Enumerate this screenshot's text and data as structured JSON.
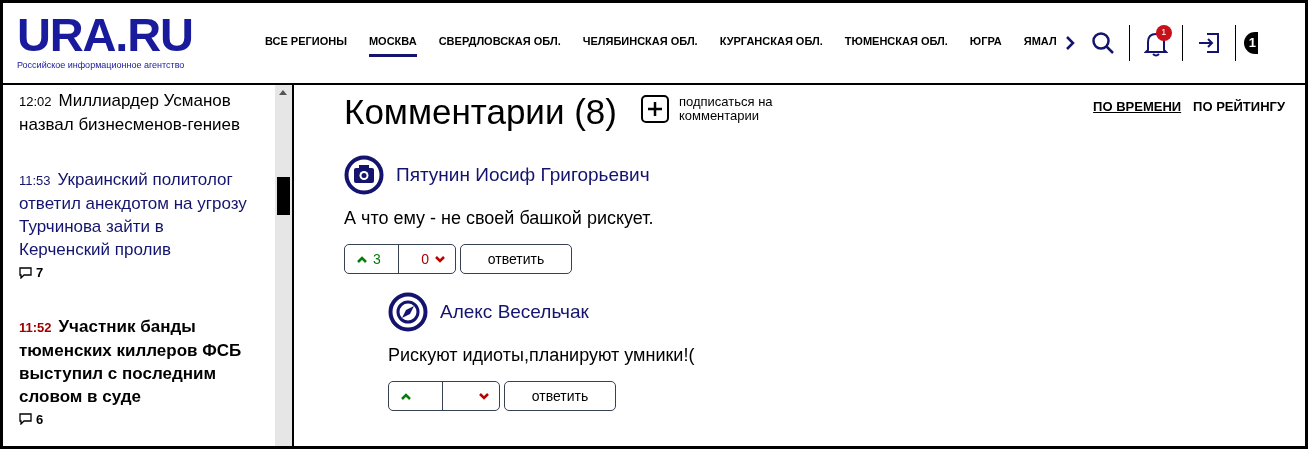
{
  "header": {
    "logo": "URA.RU",
    "tagline": "Российское информационное агентство",
    "nav": [
      {
        "label": "ВСЕ РЕГИОНЫ",
        "selected": false
      },
      {
        "label": "МОСКВА",
        "selected": true
      },
      {
        "label": "СВЕРДЛОВСКАЯ ОБЛ.",
        "selected": false
      },
      {
        "label": "ЧЕЛЯБИНСКАЯ ОБЛ.",
        "selected": false
      },
      {
        "label": "КУРГАНСКАЯ ОБЛ.",
        "selected": false
      },
      {
        "label": "ТЮМЕНСКАЯ ОБЛ.",
        "selected": false
      },
      {
        "label": "ЮГРА",
        "selected": false
      },
      {
        "label": "ЯМАЛ",
        "selected": false
      }
    ],
    "notifications_badge": "1",
    "edge_badge": "1"
  },
  "news_feed": [
    {
      "kind": "plain",
      "time": "12:02",
      "title": "Миллиардер Усманов назвал бизнесменов-гениев"
    },
    {
      "kind": "visited",
      "time": "11:53",
      "title": "Украинский политолог ответил анекдотом на угрозу Турчинова зайти в Керченский пролив",
      "comments": "7"
    },
    {
      "kind": "hot",
      "time": "11:52",
      "title": "Участник банды тюменских киллеров ФСБ выступил с последним словом в суде",
      "comments": "6"
    }
  ],
  "comments_section": {
    "title": "Комментарии (8)",
    "subscribe": "подписаться на комментарии",
    "sort": [
      {
        "label": "ПО ВРЕМЕНИ",
        "selected": true
      },
      {
        "label": "ПО РЕЙТИНГУ",
        "selected": false
      }
    ],
    "comments": [
      {
        "author": "Пятунин Иосиф Григорьевич",
        "kind": "camera",
        "text": "А что ему - не своей башкой рискует.",
        "upvotes": "3",
        "downvotes": "0",
        "reply": "ответить",
        "children": [
          {
            "author": "Алекс Весельчак",
            "kind": "compass",
            "text": "Рискуют идиоты,планируют умники!(",
            "reply": "ответить"
          }
        ]
      }
    ]
  }
}
